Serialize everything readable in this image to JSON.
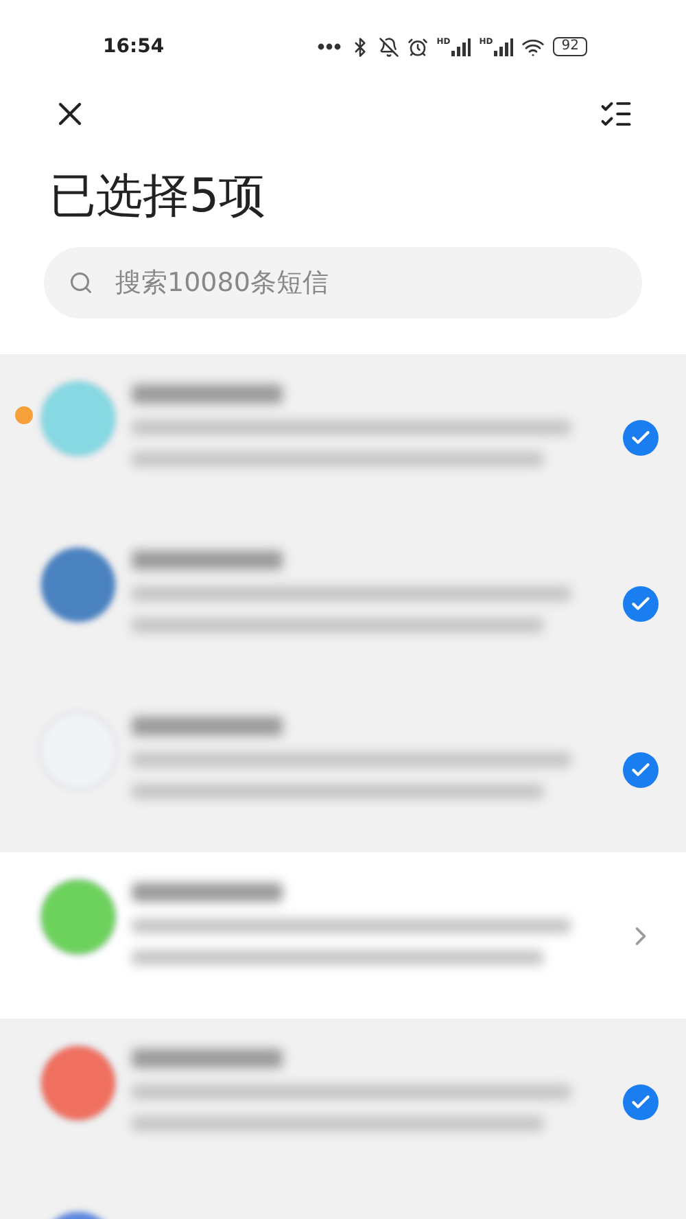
{
  "status_bar": {
    "time": "16:54",
    "signal_labels": [
      "HD",
      "HD"
    ],
    "battery": "92"
  },
  "header": {
    "title": "已选择5项"
  },
  "search": {
    "placeholder": "搜索10080条短信"
  },
  "conversations": [
    {
      "selected": true,
      "unread": true,
      "color": "#86d8e2"
    },
    {
      "selected": true,
      "unread": false,
      "color": "#4a82c0"
    },
    {
      "selected": true,
      "unread": false,
      "color": "#f2f3f6"
    },
    {
      "selected": false,
      "unread": false,
      "color": "#6dd25c"
    },
    {
      "selected": true,
      "unread": false,
      "color": "#f07060"
    },
    {
      "selected": true,
      "unread": false,
      "color": "#5a86e0"
    }
  ]
}
